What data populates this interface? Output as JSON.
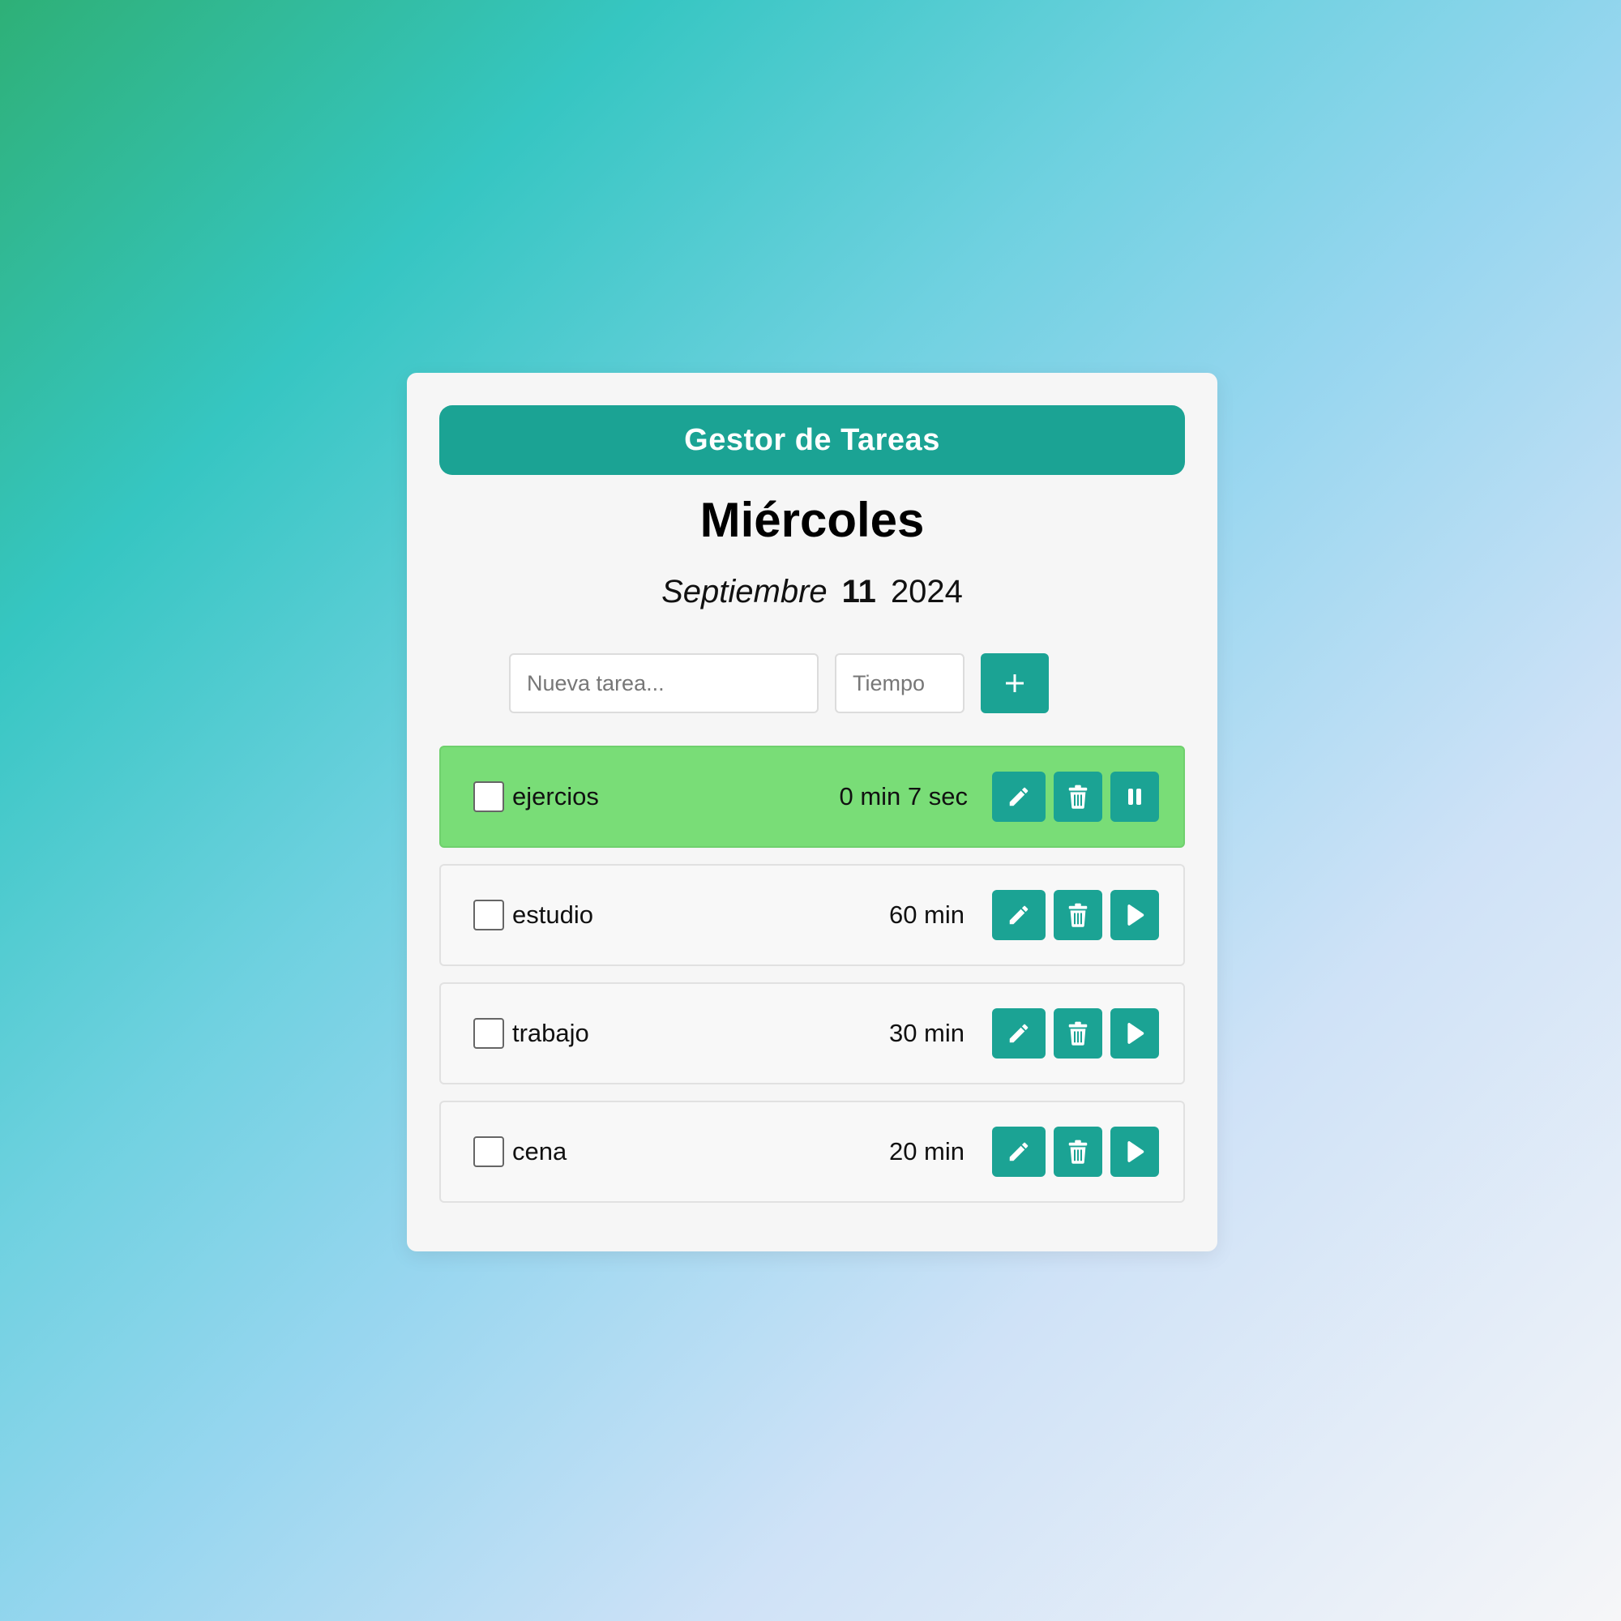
{
  "header": {
    "title": "Gestor de Tareas"
  },
  "date": {
    "day_name": "Miércoles",
    "month": "Septiembre",
    "day": "11",
    "year": "2024"
  },
  "new_task": {
    "task_placeholder": "Nueva tarea...",
    "time_placeholder": "Tiempo",
    "add_icon": "plus-icon"
  },
  "tasks": [
    {
      "name": "ejercios",
      "time": "0 min 7 sec",
      "active": true,
      "checked": false,
      "toggle_icon": "pause-icon"
    },
    {
      "name": "estudio",
      "time": "60 min",
      "active": false,
      "checked": false,
      "toggle_icon": "play-icon"
    },
    {
      "name": "trabajo",
      "time": "30 min",
      "active": false,
      "checked": false,
      "toggle_icon": "play-icon"
    },
    {
      "name": "cena",
      "time": "20 min",
      "active": false,
      "checked": false,
      "toggle_icon": "play-icon"
    }
  ],
  "icons": {
    "edit": "pencil-icon",
    "delete": "trash-icon"
  },
  "colors": {
    "accent": "#1ba394",
    "active_task": "#79dd77",
    "card_bg": "#f6f6f6"
  }
}
